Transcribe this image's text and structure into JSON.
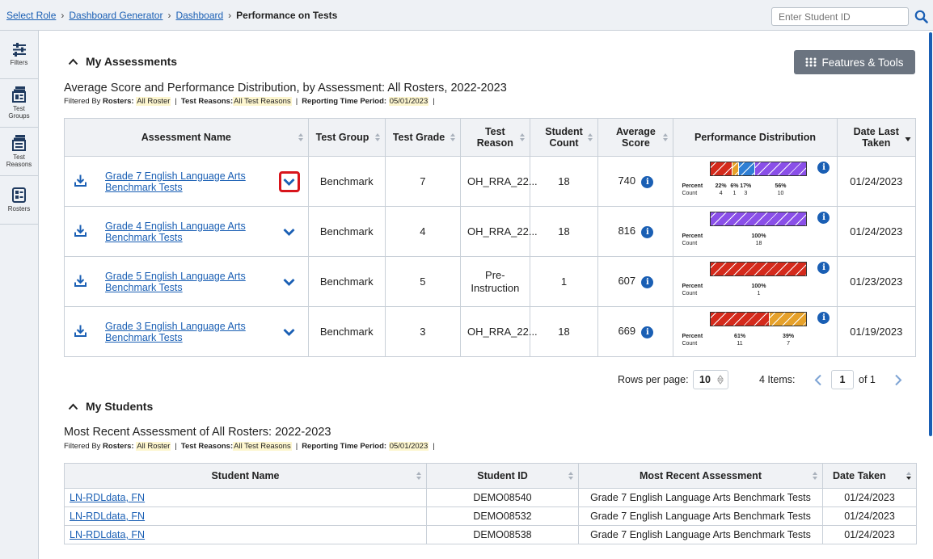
{
  "breadcrumb": {
    "items": [
      "Select Role",
      "Dashboard Generator",
      "Dashboard"
    ],
    "current": "Performance on Tests"
  },
  "search": {
    "placeholder": "Enter Student ID"
  },
  "sidebar": {
    "items": [
      {
        "label": "Filters",
        "icon": "sliders-icon"
      },
      {
        "label": "Test Groups",
        "icon": "test-groups-icon"
      },
      {
        "label": "Test Reasons",
        "icon": "test-reasons-icon"
      },
      {
        "label": "Rosters",
        "icon": "rosters-icon"
      }
    ]
  },
  "assessments": {
    "heading": "My Assessments",
    "features_button": "Features & Tools",
    "subtitle": "Average Score and Performance Distribution, by Assessment: All Rosters, 2022-2023",
    "filters": {
      "prefix": "Filtered By",
      "rosters_label": "Rosters:",
      "rosters_value": "All Roster",
      "reasons_label": "Test Reasons:",
      "reasons_value": "All Test Reasons",
      "period_label": "Reporting Time Period:",
      "period_value": "05/01/2023"
    },
    "columns": [
      "Assessment Name",
      "Test Group",
      "Test Grade",
      "Test Reason",
      "Student Count",
      "Average Score",
      "Performance Distribution",
      "Date Last Taken"
    ],
    "pd_labels": {
      "percent": "Percent",
      "count": "Count"
    },
    "rows": [
      {
        "name": "Grade 7 English Language Arts Benchmark Tests",
        "group": "Benchmark",
        "grade": "7",
        "reason": "OH_RRA_22...",
        "count": "18",
        "avg": "740",
        "date": "01/24/2023",
        "dist": [
          {
            "color": "#d42a1c",
            "pct": "22%",
            "count": "4",
            "frac": 0.22
          },
          {
            "color": "#e6a12a",
            "pct": "6%",
            "count": "1",
            "frac": 0.06
          },
          {
            "color": "#2f7fd4",
            "pct": "17%",
            "count": "3",
            "frac": 0.17
          },
          {
            "color": "#8a4fe8",
            "pct": "56%",
            "count": "10",
            "frac": 0.55
          }
        ]
      },
      {
        "name": "Grade 4 English Language Arts Benchmark Tests",
        "group": "Benchmark",
        "grade": "4",
        "reason": "OH_RRA_22...",
        "count": "18",
        "avg": "816",
        "date": "01/24/2023",
        "dist": [
          {
            "color": "#8a4fe8",
            "pct": "100%",
            "count": "18",
            "frac": 1
          }
        ]
      },
      {
        "name": "Grade 5 English Language Arts Benchmark Tests",
        "group": "Benchmark",
        "grade": "5",
        "reason": "Pre-Instruction",
        "count": "1",
        "avg": "607",
        "date": "01/23/2023",
        "dist": [
          {
            "color": "#d42a1c",
            "pct": "100%",
            "count": "1",
            "frac": 1
          }
        ]
      },
      {
        "name": "Grade 3 English Language Arts Benchmark Tests",
        "group": "Benchmark",
        "grade": "3",
        "reason": "OH_RRA_22...",
        "count": "18",
        "avg": "669",
        "date": "01/19/2023",
        "dist": [
          {
            "color": "#d42a1c",
            "pct": "61%",
            "count": "11",
            "frac": 0.61
          },
          {
            "color": "#e6a12a",
            "pct": "39%",
            "count": "7",
            "frac": 0.39
          }
        ]
      }
    ],
    "pager": {
      "rows_label": "Rows per page:",
      "rows_value": "10",
      "items_label": "4 Items:",
      "page": "1",
      "of_label": "of 1"
    }
  },
  "students": {
    "heading": "My Students",
    "subtitle": "Most Recent Assessment of All Rosters: 2022-2023",
    "filters": {
      "prefix": "Filtered By",
      "rosters_label": "Rosters:",
      "rosters_value": "All Roster",
      "reasons_label": "Test Reasons:",
      "reasons_value": "All Test Reasons",
      "period_label": "Reporting Time Period:",
      "period_value": "05/01/2023"
    },
    "columns": [
      "Student Name",
      "Student ID",
      "Most Recent Assessment",
      "Date Taken"
    ],
    "rows": [
      {
        "name": "LN-RDLdata, FN",
        "id": "DEMO08540",
        "assessment": "Grade 7 English Language Arts Benchmark Tests",
        "date": "01/24/2023"
      },
      {
        "name": "LN-RDLdata, FN",
        "id": "DEMO08532",
        "assessment": "Grade 7 English Language Arts Benchmark Tests",
        "date": "01/24/2023"
      },
      {
        "name": "LN-RDLdata, FN",
        "id": "DEMO08538",
        "assessment": "Grade 7 English Language Arts Benchmark Tests",
        "date": "01/24/2023"
      }
    ]
  }
}
